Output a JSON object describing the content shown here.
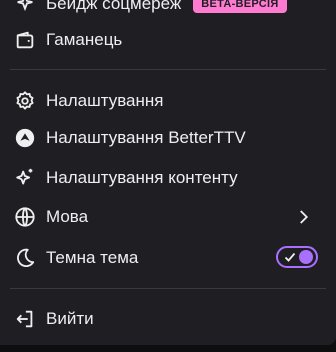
{
  "colors": {
    "menu_bg": "#1f1f23",
    "text": "#efeff1",
    "divider": "#3a3a3d",
    "accent": "#a970ff",
    "badge_bg": "#ff7ad1"
  },
  "menu": {
    "social_badge": {
      "label": "Бейдж соцмереж",
      "badge": "BETA-ВЕРСІЯ",
      "icon": "badge-sparkle-icon"
    },
    "wallet": {
      "label": "Гаманець",
      "icon": "wallet-icon"
    },
    "settings": {
      "label": "Налаштування",
      "icon": "gear-icon"
    },
    "bttv_settings": {
      "label": "Налаштування BetterTTV",
      "icon": "bttv-icon"
    },
    "content_settings": {
      "label": "Налаштування контенту",
      "icon": "sparkles-icon"
    },
    "language": {
      "label": "Мова",
      "icon": "globe-icon",
      "trailing_icon": "chevron-right-icon"
    },
    "dark_theme": {
      "label": "Темна тема",
      "icon": "moon-icon",
      "enabled": true
    },
    "logout": {
      "label": "Вийти",
      "icon": "logout-icon"
    }
  }
}
